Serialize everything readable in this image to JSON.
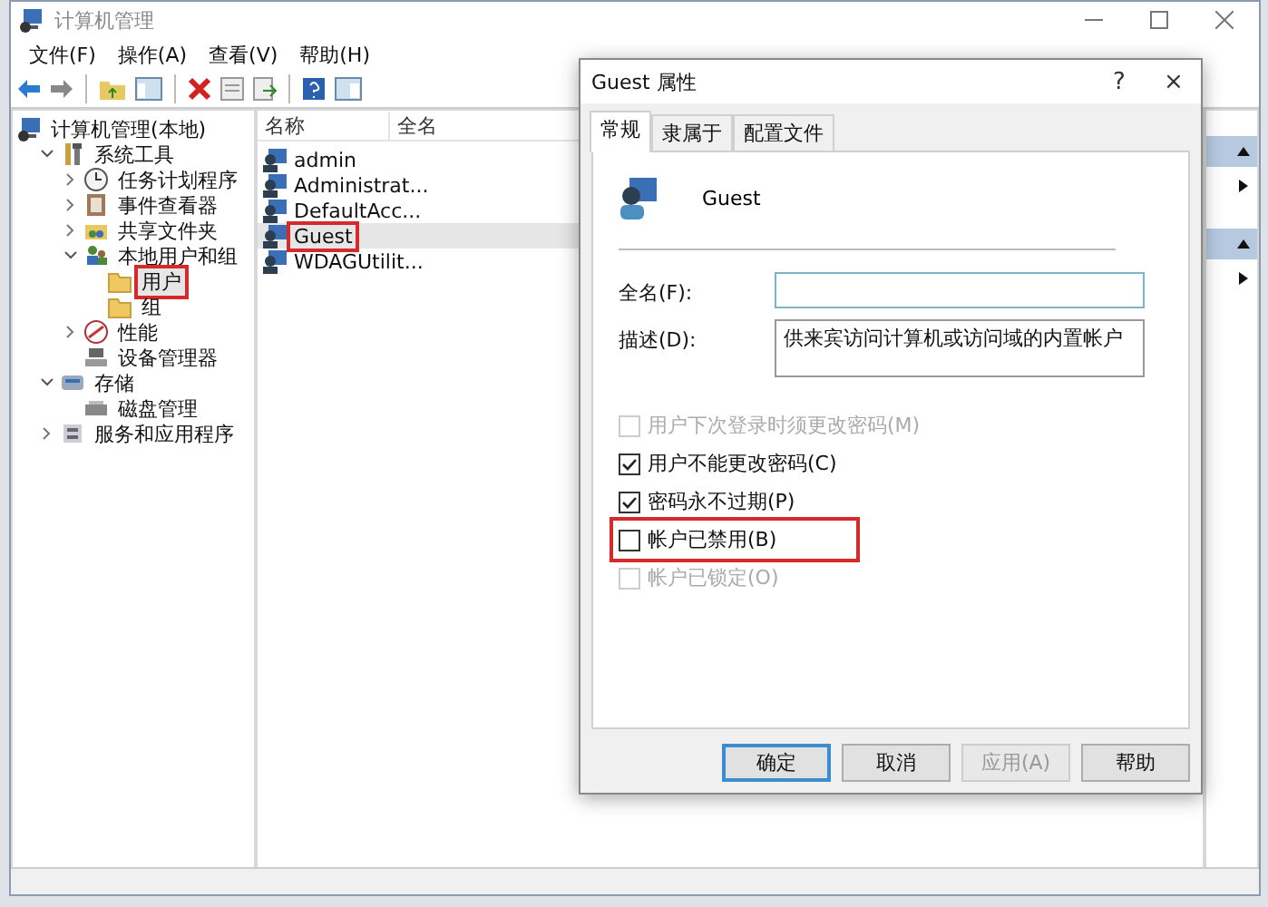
{
  "window": {
    "title": "计算机管理"
  },
  "menu": [
    "文件(F)",
    "操作(A)",
    "查看(V)",
    "帮助(H)"
  ],
  "tree": [
    {
      "label": "计算机管理(本地)",
      "kind": "computer",
      "children": [
        {
          "label": "系统工具",
          "kind": "tools",
          "expanded": true,
          "children": [
            {
              "label": "任务计划程序",
              "kind": "clock",
              "expanded": false
            },
            {
              "label": "事件查看器",
              "kind": "log",
              "expanded": false
            },
            {
              "label": "共享文件夹",
              "kind": "share",
              "expanded": false
            },
            {
              "label": "本地用户和组",
              "kind": "users",
              "expanded": true,
              "children": [
                {
                  "label": "用户",
                  "kind": "folder",
                  "selected": true,
                  "highlighted": true
                },
                {
                  "label": "组",
                  "kind": "folder",
                  "selected": false,
                  "highlighted": false
                }
              ]
            },
            {
              "label": "性能",
              "kind": "perf",
              "expanded": false
            },
            {
              "label": "设备管理器",
              "kind": "device"
            }
          ]
        },
        {
          "label": "存储",
          "kind": "storage",
          "expanded": true,
          "children": [
            {
              "label": "磁盘管理",
              "kind": "disk"
            }
          ]
        },
        {
          "label": "服务和应用程序",
          "kind": "services",
          "expanded": false
        }
      ]
    }
  ],
  "list": {
    "columns": [
      "名称",
      "全名"
    ],
    "rows": [
      {
        "name": "admin",
        "selected": false,
        "highlighted": false
      },
      {
        "name": "Administrat...",
        "selected": false,
        "highlighted": false
      },
      {
        "name": "DefaultAcc...",
        "selected": false,
        "highlighted": false
      },
      {
        "name": "Guest",
        "selected": true,
        "highlighted": true
      },
      {
        "name": "WDAGUtilit...",
        "selected": false,
        "highlighted": false
      }
    ]
  },
  "dialog": {
    "title": "Guest 属性",
    "help": "?",
    "close": "×",
    "tabs": [
      {
        "label": "常规",
        "selected": true
      },
      {
        "label": "隶属于",
        "selected": false
      },
      {
        "label": "配置文件",
        "selected": false
      }
    ],
    "user_name": "Guest",
    "full_name": {
      "label": "全名(F):"
    },
    "description": {
      "label": "描述(D):",
      "value": "供来宾访问计算机或访问域的内置帐户"
    },
    "checkboxes": [
      {
        "label": "用户下次登录时须更改密码(M)",
        "checked": false,
        "disabled": true,
        "highlighted": false
      },
      {
        "label": "用户不能更改密码(C)",
        "checked": true,
        "disabled": false,
        "highlighted": false
      },
      {
        "label": "密码永不过期(P)",
        "checked": true,
        "disabled": false,
        "highlighted": false
      },
      {
        "label": "帐户已禁用(B)",
        "checked": false,
        "disabled": false,
        "highlighted": true
      },
      {
        "label": "帐户已锁定(O)",
        "checked": false,
        "disabled": true,
        "highlighted": false
      }
    ],
    "buttons": [
      {
        "label": "确定",
        "kind": "default",
        "disabled": false
      },
      {
        "label": "取消",
        "kind": "normal",
        "disabled": false
      },
      {
        "label": "应用(A)",
        "kind": "normal",
        "disabled": true
      },
      {
        "label": "帮助",
        "kind": "normal",
        "disabled": false
      }
    ]
  }
}
